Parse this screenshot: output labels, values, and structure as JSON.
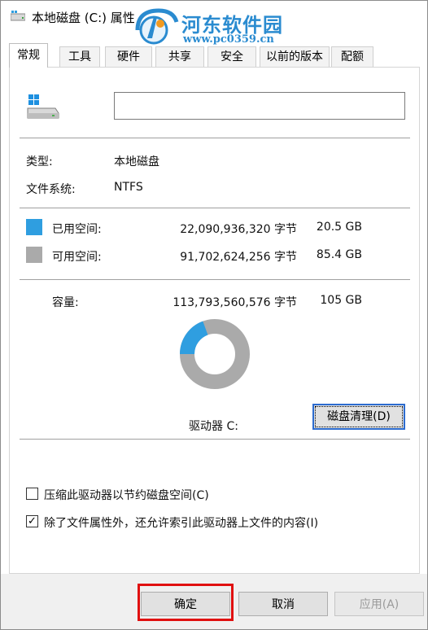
{
  "window": {
    "title": "本地磁盘 (C:) 属性"
  },
  "watermark": {
    "title": "河东软件园",
    "url": "www.pc0359.cn"
  },
  "tabs": [
    {
      "label": "常规",
      "active": true
    },
    {
      "label": "工具"
    },
    {
      "label": "硬件"
    },
    {
      "label": "共享"
    },
    {
      "label": "安全"
    },
    {
      "label": "以前的版本"
    },
    {
      "label": "配额"
    }
  ],
  "general": {
    "name_value": "",
    "type_label": "类型:",
    "type_value": "本地磁盘",
    "fs_label": "文件系统:",
    "fs_value": "NTFS",
    "used": {
      "label": "已用空间:",
      "bytes": "22,090,936,320 字节",
      "size": "20.5 GB",
      "color": "#2f9ee0"
    },
    "free": {
      "label": "可用空间:",
      "bytes": "91,702,624,256 字节",
      "size": "85.4 GB",
      "color": "#aaaaaa"
    },
    "capacity": {
      "label": "容量:",
      "bytes": "113,793,560,576 字节",
      "size": "105 GB"
    },
    "used_fraction": 0.194,
    "drive_label": "驱动器 C:",
    "cleanup_button": "磁盘清理(D)",
    "compress_checkbox": {
      "label": "压缩此驱动器以节约磁盘空间(C)",
      "checked": false
    },
    "index_checkbox": {
      "label": "除了文件属性外，还允许索引此驱动器上文件的内容(I)",
      "checked": true
    }
  },
  "footer": {
    "ok": "确定",
    "cancel": "取消",
    "apply": "应用(A)",
    "highlight_color": "#e01010"
  },
  "icons": {
    "title": "drive-icon",
    "drive": "hard-drive-windows-icon"
  }
}
